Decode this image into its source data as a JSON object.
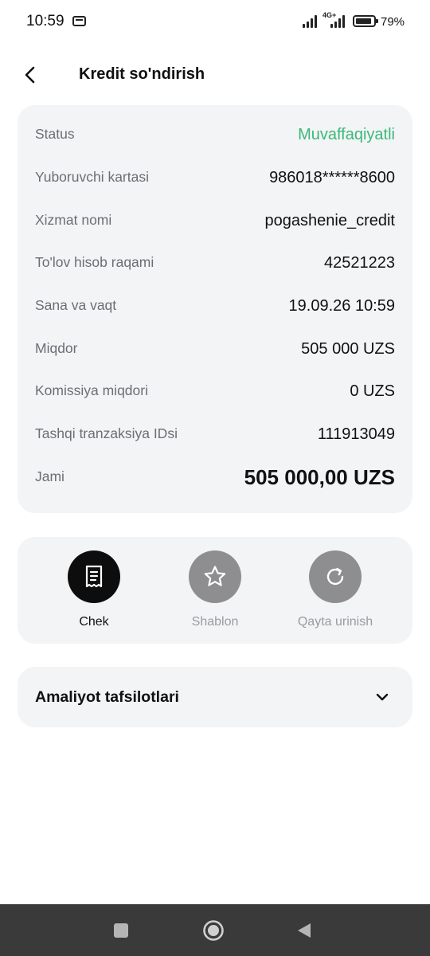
{
  "status_bar": {
    "time": "10:59",
    "network": "4G+",
    "battery": "79%",
    "battery_level": 0.79
  },
  "header": {
    "title": "Kredit so'ndirish"
  },
  "details": [
    {
      "label": "Status",
      "value": "Muvaffaqiyatli",
      "color": "#3cb878"
    },
    {
      "label": "Yuboruvchi kartasi",
      "value": "986018******8600"
    },
    {
      "label": "Xizmat nomi",
      "value": "pogashenie_credit"
    },
    {
      "label": "To'lov hisob raqami",
      "value": "42521223"
    },
    {
      "label": "Sana va vaqt",
      "value": "19.09.26 10:59"
    },
    {
      "label": "Miqdor",
      "value": "505 000 UZS"
    },
    {
      "label": "Komissiya miqdori",
      "value": "0 UZS"
    },
    {
      "label": "Tashqi tranzaksiya IDsi",
      "value": "111913049"
    },
    {
      "label": "Jami",
      "value": "505 000,00  UZS"
    }
  ],
  "actions": [
    {
      "label": "Chek",
      "icon": "receipt-icon",
      "active": true
    },
    {
      "label": "Shablon",
      "icon": "star-icon",
      "active": false
    },
    {
      "label": "Qayta urinish",
      "icon": "retry-icon",
      "active": false
    }
  ],
  "expander": {
    "title": "Amaliyot tafsilotlari",
    "icon": "chevron-down-icon"
  },
  "navbar": {
    "buttons": [
      "recents-button",
      "home-button",
      "back-nav-button"
    ]
  },
  "colors": {
    "success": "#3cb878",
    "card_bg": "#f3f4f6",
    "primary_action": "#0d0d0d",
    "inactive_action": "#8e8e90"
  }
}
